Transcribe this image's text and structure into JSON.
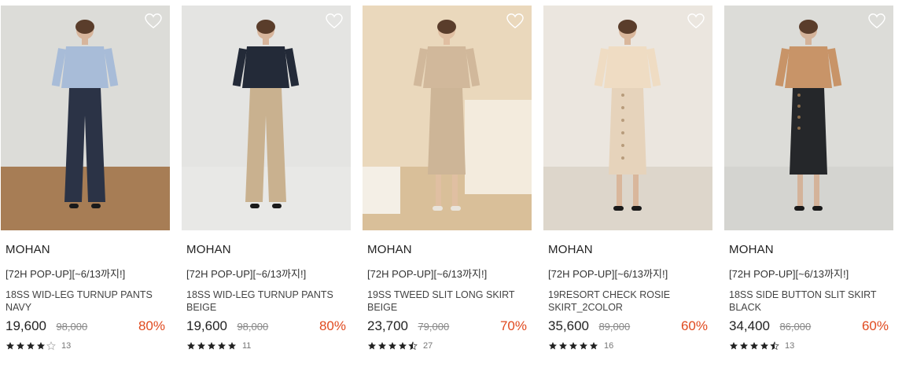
{
  "products": [
    {
      "brand": "MOHAN",
      "promo": "[72H POP-UP][~6/13까지!]",
      "name": "18SS WID-LEG TURNUP PANTS NAVY",
      "price": "19,600",
      "original_price": "98,000",
      "discount": "80%",
      "rating": 4,
      "review_count": "13",
      "colors": {
        "bg": "#dcdcd8",
        "floor": "#a77d55",
        "top": "#a8bcd8",
        "bottom": "#2b3346",
        "skin": "#d7b59c"
      }
    },
    {
      "brand": "MOHAN",
      "promo": "[72H POP-UP][~6/13까지!]",
      "name": "18SS WID-LEG TURNUP PANTS BEIGE",
      "price": "19,600",
      "original_price": "98,000",
      "discount": "80%",
      "rating": 5,
      "review_count": "11",
      "colors": {
        "bg": "#e4e4e2",
        "floor": "#e8e8e6",
        "top": "#232a38",
        "bottom": "#c9b18f",
        "skin": "#d7b59c"
      }
    },
    {
      "brand": "MOHAN",
      "promo": "[72H POP-UP][~6/13까지!]",
      "name": "19SS TWEED SLIT LONG SKIRT BEIGE",
      "price": "23,700",
      "original_price": "79,000",
      "discount": "70%",
      "rating": 4.5,
      "review_count": "27",
      "colors": {
        "bg": "#ead8bc",
        "floor": "#d9bf99",
        "top": "#d1b89b",
        "bottom": "#cdb597",
        "skin": "#e0bfa2"
      }
    },
    {
      "brand": "MOHAN",
      "promo": "[72H POP-UP][~6/13까지!]",
      "name": "19RESORT CHECK ROSIE SKIRT_2COLOR",
      "price": "35,600",
      "original_price": "89,000",
      "discount": "60%",
      "rating": 5,
      "review_count": "16",
      "colors": {
        "bg": "#ebe6df",
        "floor": "#ddd6cb",
        "top": "#efdcc3",
        "bottom": "#e6d3bb",
        "skin": "#d9b79c"
      }
    },
    {
      "brand": "MOHAN",
      "promo": "[72H POP-UP][~6/13까지!]",
      "name": "18SS SIDE BUTTON SLIT SKIRT BLACK",
      "price": "34,400",
      "original_price": "86,000",
      "discount": "60%",
      "rating": 4.5,
      "review_count": "13",
      "colors": {
        "bg": "#dcdcd8",
        "floor": "#d4d4d0",
        "top": "#c89468",
        "bottom": "#25272a",
        "skin": "#d4b39a"
      }
    }
  ]
}
